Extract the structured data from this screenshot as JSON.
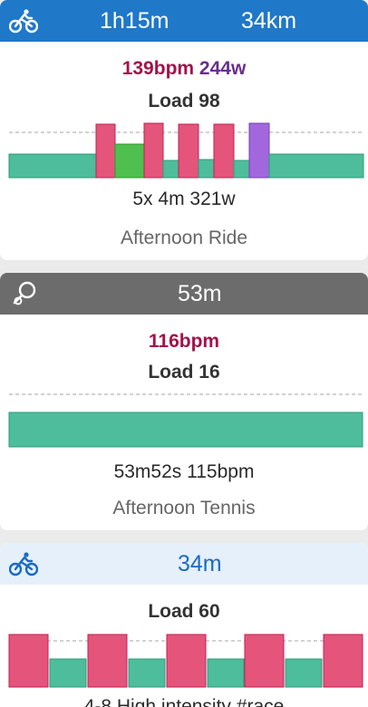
{
  "colors": {
    "ride_header": "#1f78c8",
    "tennis_header": "#6c6c6c",
    "ride2_header_bg": "#e6f0fb",
    "ride2_header_text": "#1a6bc0",
    "heart_rate": "#a3124a",
    "power": "#6a2d8c",
    "zone_teal": "#4dbd9c",
    "zone_pink": "#e5547a",
    "zone_green": "#4fbf4f",
    "zone_purple": "#a267dc",
    "card_bg": "#ffffff",
    "feed_bg": "#ebebeb"
  },
  "cards": [
    {
      "icon": "bike-icon",
      "duration": "1h15m",
      "distance": "34km",
      "heart_rate": "139bpm",
      "power": "244w",
      "load": "Load 98",
      "summary": "5x 4m 321w",
      "title": "Afternoon Ride"
    },
    {
      "icon": "racket-icon",
      "duration": "53m",
      "heart_rate": "116bpm",
      "load": "Load 16",
      "summary": "53m52s 115bpm",
      "title": "Afternoon Tennis"
    },
    {
      "icon": "bike-icon",
      "duration": "34m",
      "load": "Load 60",
      "title_partial": "4-8 High intensity #race"
    }
  ]
}
